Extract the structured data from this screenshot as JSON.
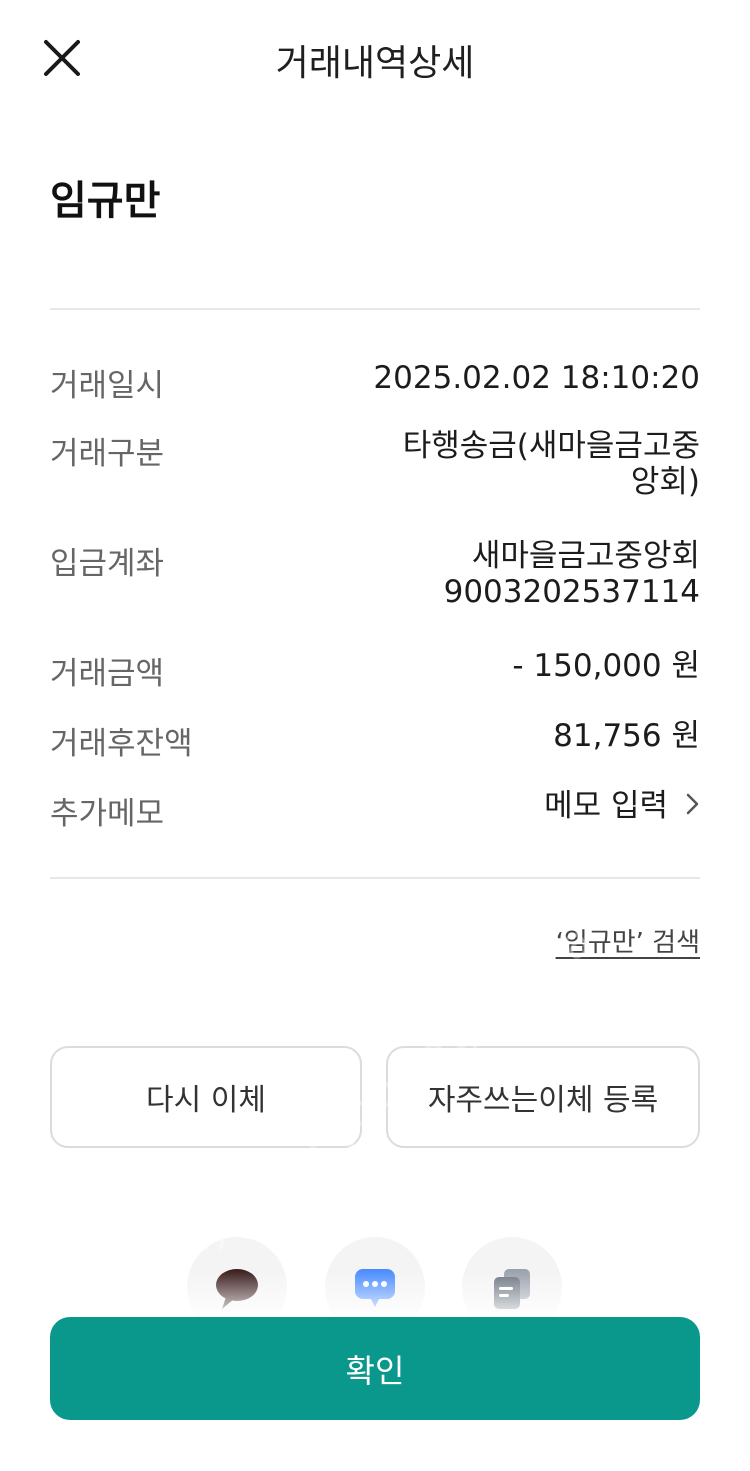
{
  "header": {
    "title": "거래내역상세",
    "close_icon": "close-icon"
  },
  "recipient": "임규만",
  "details": {
    "datetime": {
      "label": "거래일시",
      "value": "2025.02.02 18:10:20"
    },
    "type": {
      "label": "거래구분",
      "value_line1": "타행송금(새마을금고중",
      "value_line2": "앙회)"
    },
    "account": {
      "label": "입금계좌",
      "value_line1": "새마을금고중앙회",
      "value_line2": "9003202537114"
    },
    "amount": {
      "label": "거래금액",
      "value": "- 150,000 원"
    },
    "balance": {
      "label": "거래후잔액",
      "value": "81,756 원"
    },
    "memo": {
      "label": "추가메모",
      "value": "메모 입력",
      "icon": "chevron-right-icon"
    }
  },
  "search_link": "‘임규만’ 검색",
  "actions": {
    "retransfer": "다시 이체",
    "favorite": "자주쓰는이체 등록"
  },
  "share": {
    "items": [
      "kakaotalk-icon",
      "message-icon",
      "copy-icon"
    ]
  },
  "confirm": "확인",
  "colors": {
    "primary": "#0a978c",
    "kakao": "#3c1e1e",
    "message": "#4a8cff",
    "copy": "#6b7380"
  },
  "watermark": "bunjang · joonggonara"
}
